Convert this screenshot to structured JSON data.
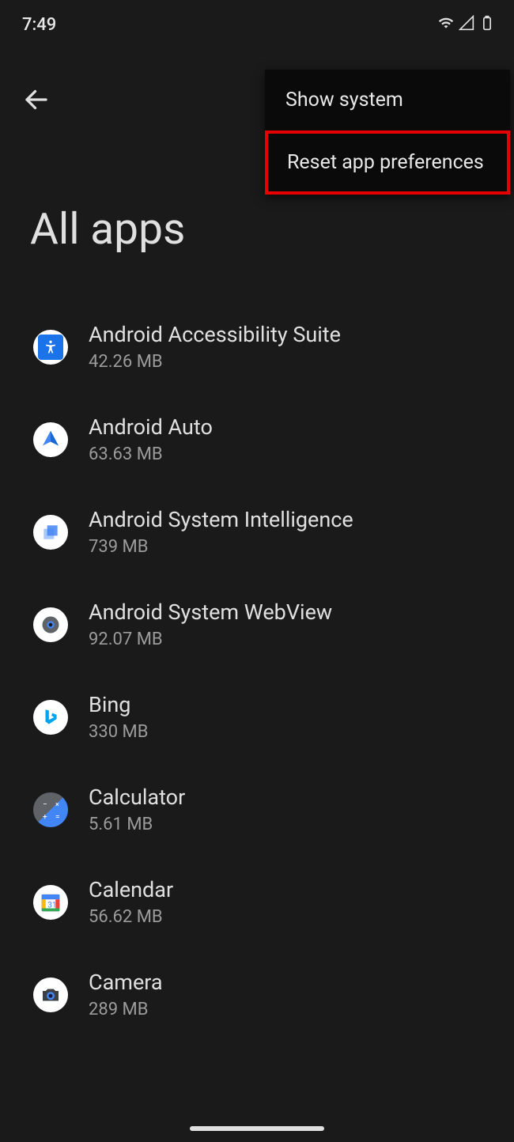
{
  "status": {
    "time": "7:49"
  },
  "menu": {
    "show_system": "Show system",
    "reset_prefs": "Reset app preferences"
  },
  "page": {
    "title": "All apps"
  },
  "apps": [
    {
      "name": "Android Accessibility Suite",
      "size": "42.26 MB",
      "icon": "accessibility"
    },
    {
      "name": "Android Auto",
      "size": "63.63 MB",
      "icon": "auto"
    },
    {
      "name": "Android System Intelligence",
      "size": "739 MB",
      "icon": "sysintel"
    },
    {
      "name": "Android System WebView",
      "size": "92.07 MB",
      "icon": "webview"
    },
    {
      "name": "Bing",
      "size": "330 MB",
      "icon": "bing"
    },
    {
      "name": "Calculator",
      "size": "5.61 MB",
      "icon": "calculator"
    },
    {
      "name": "Calendar",
      "size": "56.62 MB",
      "icon": "calendar"
    },
    {
      "name": "Camera",
      "size": "289 MB",
      "icon": "camera"
    }
  ]
}
